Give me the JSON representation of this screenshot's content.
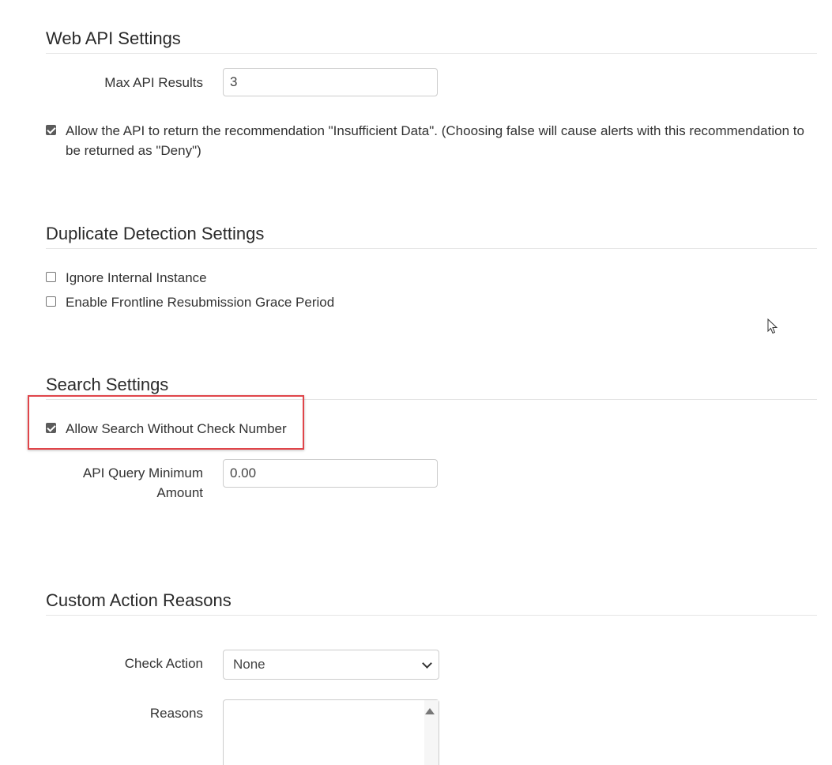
{
  "web_api": {
    "title": "Web API Settings",
    "max_results_label": "Max API Results",
    "max_results_value": "3",
    "insufficient_data": {
      "checked": true,
      "label": "Allow the API to return the recommendation \"Insufficient Data\". (Choosing false will cause alerts with this recommendation to be returned as \"Deny\")"
    }
  },
  "duplicate": {
    "title": "Duplicate Detection Settings",
    "ignore_internal": {
      "checked": false,
      "label": "Ignore Internal Instance"
    },
    "grace_period": {
      "checked": false,
      "label": "Enable Frontline Resubmission Grace Period"
    }
  },
  "search": {
    "title": "Search Settings",
    "allow_no_check_number": {
      "checked": true,
      "label": "Allow Search Without Check Number"
    },
    "min_amount_label": "API Query Minimum Amount",
    "min_amount_value": "0.00"
  },
  "custom_actions": {
    "title": "Custom Action Reasons",
    "check_action_label": "Check Action",
    "check_action_selected": "None",
    "reasons_label": "Reasons"
  },
  "colors": {
    "highlight": "#e0454a"
  }
}
